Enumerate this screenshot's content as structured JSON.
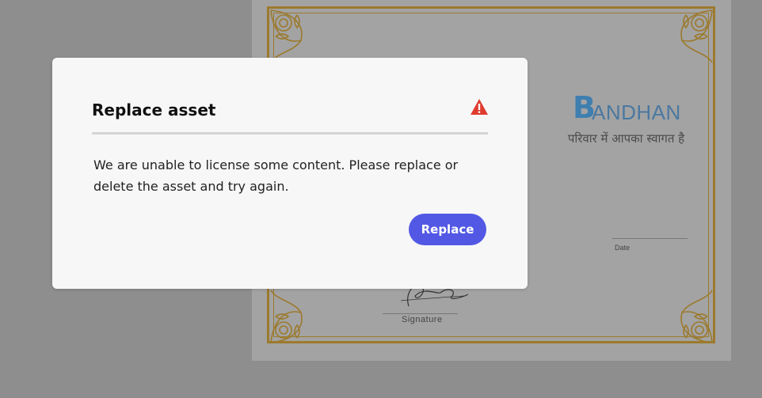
{
  "certificate": {
    "logo_initial": "B",
    "logo_rest": "ANDHAN",
    "tagline": "परिवार में आपका स्वागत है",
    "date_label": "Date",
    "signature_label": "Signature"
  },
  "dialog": {
    "title": "Replace asset",
    "message": "We are unable to license some content. Please replace or delete the asset and try again.",
    "replace_label": "Replace",
    "alert_icon": "alert-icon"
  },
  "colors": {
    "accent": "#5258e4",
    "alert": "#e03b2f",
    "border_gold": "#9c7a2d"
  }
}
